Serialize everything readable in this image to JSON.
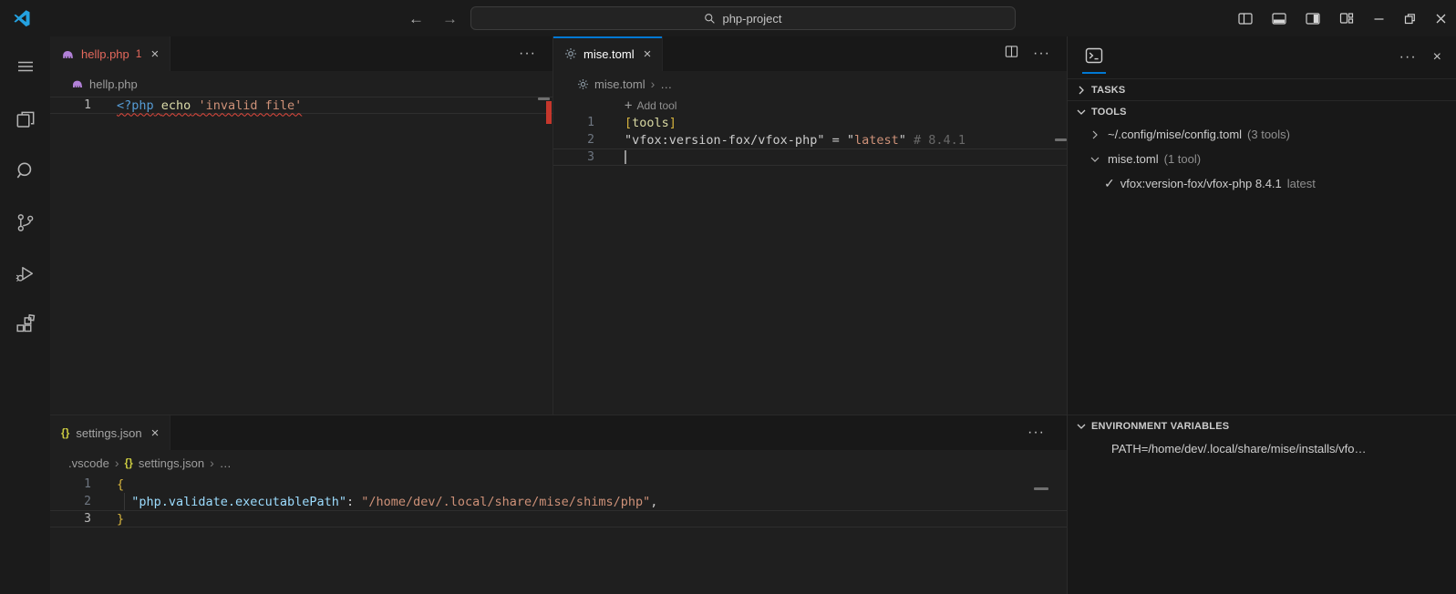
{
  "titlebar": {
    "search_value": "php-project"
  },
  "icons": {
    "back": "←",
    "forward": "→",
    "more_actions": "···",
    "close": "×",
    "check": "✓",
    "breadcrumb_separator": "›",
    "plus": "+",
    "json_braces": "{}"
  },
  "activity_bar": {
    "items": [
      "menu",
      "explorer",
      "search",
      "source-control",
      "run-debug",
      "extensions"
    ]
  },
  "editors": {
    "left": {
      "tab": {
        "label": "hellp.php",
        "badge": "1"
      },
      "breadcrumb": {
        "items": [
          "hellp.php"
        ]
      },
      "lines": [
        {
          "num": "1",
          "active": true,
          "squiggle": true,
          "tokens": [
            {
              "t": "<?php",
              "c": "blue"
            },
            {
              "t": " ",
              "c": "fg"
            },
            {
              "t": "echo",
              "c": "ident"
            },
            {
              "t": " ",
              "c": "fg"
            },
            {
              "t": "'invalid file'",
              "c": "orange"
            }
          ]
        }
      ]
    },
    "mise": {
      "tab": {
        "label": "mise.toml"
      },
      "breadcrumb": {
        "items": [
          "mise.toml",
          "…"
        ]
      },
      "codelens": {
        "label": "Add tool"
      },
      "lines": [
        {
          "num": "1",
          "tokens": [
            {
              "t": "[",
              "c": "gold"
            },
            {
              "t": "tools",
              "c": "yellowkey"
            },
            {
              "t": "]",
              "c": "gold"
            }
          ]
        },
        {
          "num": "2",
          "tokens": [
            {
              "t": "\"vfox:version-fox/vfox-php\"",
              "c": "fg"
            },
            {
              "t": " = ",
              "c": "fg"
            },
            {
              "t": "\"",
              "c": "fg"
            },
            {
              "t": "latest",
              "c": "orange"
            },
            {
              "t": "\"",
              "c": "fg"
            },
            {
              "t": " ",
              "c": "fg"
            },
            {
              "t": "# 8.4.1",
              "c": "comment"
            }
          ]
        },
        {
          "num": "3",
          "active": true,
          "cursor": true,
          "tokens": []
        }
      ]
    },
    "settings": {
      "tab": {
        "label": "settings.json"
      },
      "breadcrumb": {
        "items": [
          ".vscode",
          "settings.json",
          "…"
        ]
      },
      "lines": [
        {
          "num": "1",
          "tokens": [
            {
              "t": "{",
              "c": "gold"
            }
          ]
        },
        {
          "num": "2",
          "indent_guide": true,
          "tokens": [
            {
              "t": "  ",
              "c": "fg"
            },
            {
              "t": "\"php.validate.executablePath\"",
              "c": "key"
            },
            {
              "t": ": ",
              "c": "fg"
            },
            {
              "t": "\"/home/dev/.local/share/mise/shims/php\"",
              "c": "orange"
            },
            {
              "t": ",",
              "c": "fg"
            }
          ]
        },
        {
          "num": "3",
          "active": true,
          "tokens": [
            {
              "t": "}",
              "c": "gold"
            }
          ]
        }
      ]
    }
  },
  "panel": {
    "sections": {
      "tasks": {
        "label": "TASKS"
      },
      "tools": {
        "label": "TOOLS",
        "items": [
          {
            "label": "~/.config/mise/config.toml",
            "meta": "(3 tools)"
          },
          {
            "label": "mise.toml",
            "meta": "(1 tool)"
          },
          {
            "label": "vfox:version-fox/vfox-php 8.4.1",
            "meta": "latest"
          }
        ]
      },
      "env": {
        "label": "ENVIRONMENT VARIABLES",
        "items": [
          {
            "label": "PATH=/home/dev/.local/share/mise/installs/vfo…"
          }
        ]
      }
    }
  },
  "colors": {
    "accent": "#0078d4",
    "error": "#e5695d",
    "editor_bg": "#1f1f1f",
    "shell_bg": "#181818"
  }
}
